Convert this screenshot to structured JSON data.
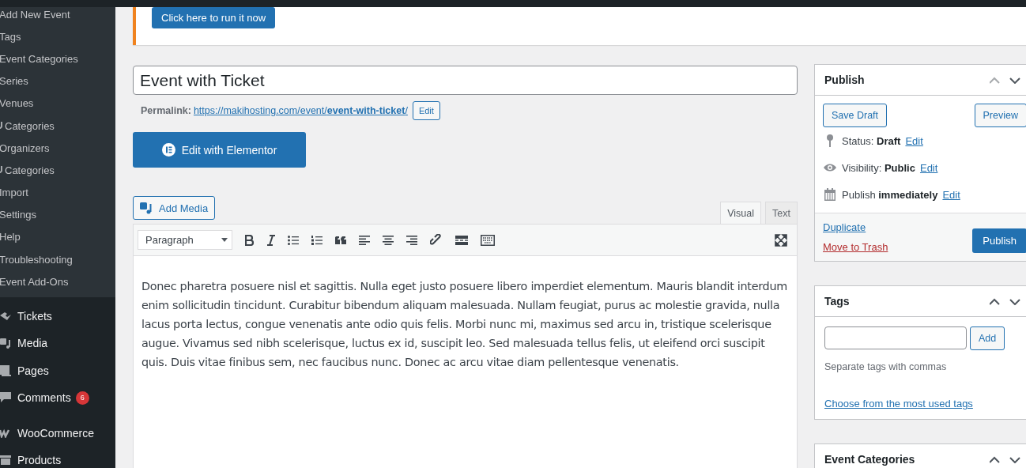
{
  "sidebar": {
    "submenu": [
      {
        "label": "Add New Event",
        "icon": false
      },
      {
        "label": "Tags",
        "icon": false
      },
      {
        "label": "Event Categories",
        "icon": false
      },
      {
        "label": "Series",
        "icon": false
      },
      {
        "label": "Venues",
        "icon": false
      },
      {
        "label": "Categories",
        "icon": true
      },
      {
        "label": "Organizers",
        "icon": false
      },
      {
        "label": "Categories",
        "icon": true
      },
      {
        "label": "Import",
        "icon": false
      },
      {
        "label": "Settings",
        "icon": false
      },
      {
        "label": "Help",
        "icon": false
      },
      {
        "label": "Troubleshooting",
        "icon": false
      },
      {
        "label": "Event Add-Ons",
        "icon": false
      }
    ],
    "menu": [
      {
        "label": "Tickets",
        "kind": "tickets"
      },
      {
        "label": "Media",
        "kind": "media"
      },
      {
        "label": "Pages",
        "kind": "pages"
      },
      {
        "label": "Comments",
        "kind": "comments",
        "badge": "6"
      },
      {
        "label": "WooCommerce",
        "kind": "woo"
      },
      {
        "label": "Products",
        "kind": "products"
      }
    ]
  },
  "notice": {
    "button": "Click here to run it now"
  },
  "editor": {
    "title": "Event with Ticket",
    "permalink_label": "Permalink:",
    "permalink_base": "https://makihosting.com/event/",
    "permalink_slug": "event-with-ticket",
    "permalink_suffix": "/",
    "permalink_edit": "Edit",
    "elementor_button": "Edit with Elementor",
    "add_media": "Add Media",
    "tabs": [
      {
        "label": "Visual",
        "selected": true
      },
      {
        "label": "Text",
        "selected": false
      }
    ],
    "format": "Paragraph",
    "content": "Donec pharetra posuere nisl et sagittis. Nulla eget justo posuere libero imperdiet elementum. Mauris blandit interdum enim sollicitudin tincidunt. Curabitur bibendum aliquam malesuada. Nullam feugiat, purus ac molestie gravida, nulla lacus porta lectus, congue venenatis ante odio quis felis. Morbi nunc mi, maximus sed arcu in, tristique scelerisque augue. Vivamus sed nibh scelerisque, luctus ex id, suscipit leo. Sed malesuada tellus felis, ut eleifend orci suscipit quis. Duis vitae finibus sem, nec faucibus nunc. Donec ac arcu vitae diam pellentesque venenatis."
  },
  "publish": {
    "title": "Publish",
    "save_draft": "Save Draft",
    "preview": "Preview",
    "rows": [
      {
        "kind": "status",
        "text": "Status: **Draft**",
        "edit": "Edit"
      },
      {
        "kind": "visibility",
        "text": "Visibility: **Public**",
        "edit": "Edit"
      },
      {
        "kind": "schedule",
        "text": "Publish **immediately**",
        "edit": "Edit"
      }
    ],
    "duplicate": "Duplicate",
    "trash": "Move to Trash",
    "publish_button": "Publish"
  },
  "tags": {
    "title": "Tags",
    "add": "Add",
    "hint": "Separate tags with commas",
    "most_used": "Choose from the most used tags"
  },
  "event_categories": {
    "title": "Event Categories"
  }
}
